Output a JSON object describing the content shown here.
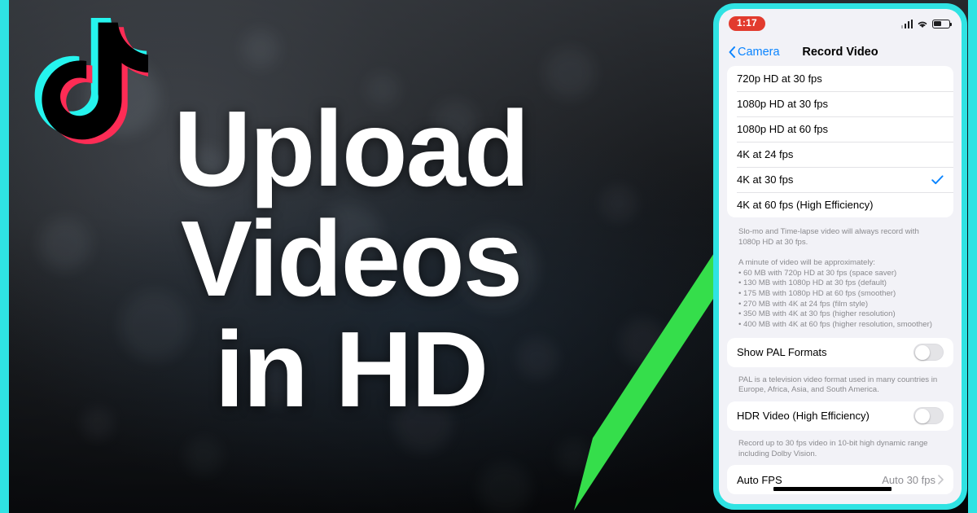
{
  "theme": {
    "accent_cyan": "#2FE3E3",
    "arrow_green": "#35DE4B",
    "ios_blue": "#0A84FF",
    "record_red": "#E23B2E",
    "headline_color": "#FFFFFF",
    "panel_bg": "#F2F2F7"
  },
  "brand": {
    "logo_name": "tiktok-logo",
    "logo_cyan": "#25F4EE",
    "logo_pink": "#FE2C55",
    "logo_black": "#000000"
  },
  "headline": {
    "line1": "Upload",
    "line2": "Videos",
    "line3": "in HD"
  },
  "annotation": {
    "arrow_name": "green-pointer-arrow",
    "arrow_target": "4K at 30 fps",
    "arrow_color": "#35DE4B",
    "tail_color": "#000000"
  },
  "phone": {
    "statusbar": {
      "recording_time": "1:17",
      "signal_icon": "cellular-signal-icon",
      "wifi_icon": "wifi-icon",
      "battery_icon": "battery-icon",
      "battery_level": 52
    },
    "navbar": {
      "back_label": "Camera",
      "back_icon": "chevron-left-icon",
      "title": "Record Video"
    },
    "format_group": {
      "options": [
        {
          "label": "720p HD at 30 fps",
          "selected": false
        },
        {
          "label": "1080p HD at 30 fps",
          "selected": false
        },
        {
          "label": "1080p HD at 60 fps",
          "selected": false
        },
        {
          "label": "4K at 24 fps",
          "selected": false
        },
        {
          "label": "4K at 30 fps",
          "selected": true
        },
        {
          "label": "4K at 60 fps (High Efficiency)",
          "selected": false
        }
      ],
      "check_icon": "checkmark-icon"
    },
    "format_footnote": "Slo-mo and Time-lapse video will always record with 1080p HD at 30 fps.\n\nA minute of video will be approximately:\n• 60 MB with 720p HD at 30 fps (space saver)\n• 130 MB with 1080p HD at 30 fps (default)\n• 175 MB with 1080p HD at 60 fps (smoother)\n• 270 MB with 4K at 24 fps (film style)\n• 350 MB with 4K at 30 fps (higher resolution)\n• 400 MB with 4K at 60 fps (higher resolution, smoother)",
    "pal_row": {
      "label": "Show PAL Formats",
      "enabled": false
    },
    "pal_footnote": "PAL is a television video format used in many countries in Europe, Africa, Asia, and South America.",
    "hdr_row": {
      "label": "HDR Video (High Efficiency)",
      "enabled": false
    },
    "hdr_footnote": "Record up to 30 fps video in 10-bit high dynamic range including Dolby Vision.",
    "autofps_row": {
      "label": "Auto FPS",
      "value": "Auto 30 fps",
      "chevron_icon": "chevron-right-icon"
    }
  }
}
